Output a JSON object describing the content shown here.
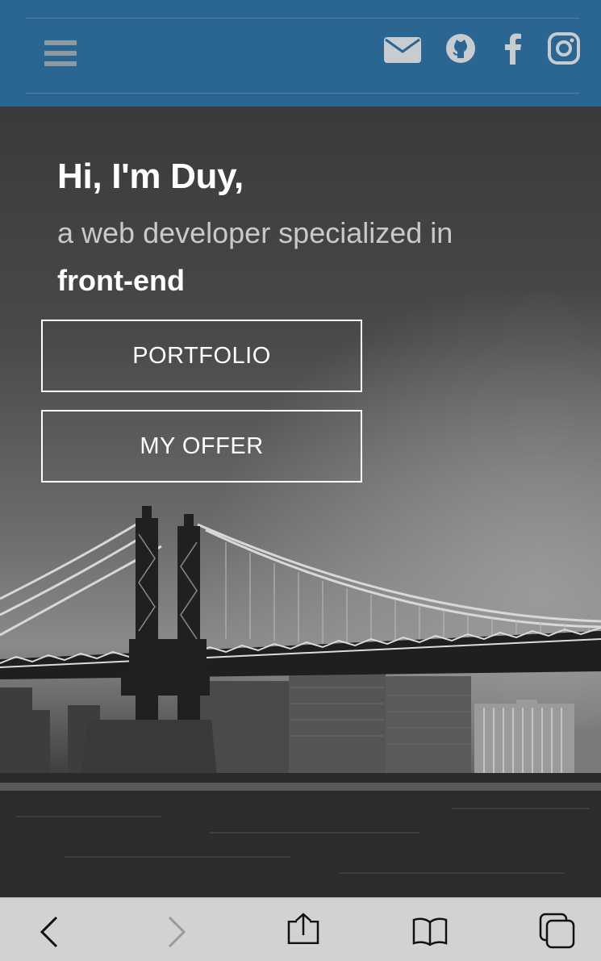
{
  "header": {
    "menu_icon": "hamburger-icon",
    "social_icons": [
      "envelope-icon",
      "github-icon",
      "facebook-icon",
      "instagram-icon"
    ],
    "color": "#2b6591"
  },
  "hero": {
    "greeting": "Hi, I'm Duy,",
    "subline": "a web developer specialized in",
    "specialty": "front-end",
    "buttons": {
      "portfolio": "PORTFOLIO",
      "offer": "MY OFFER"
    }
  },
  "browser_toolbar": {
    "icons": [
      "back-icon",
      "forward-icon",
      "share-icon",
      "bookmarks-icon",
      "tabs-icon"
    ]
  }
}
